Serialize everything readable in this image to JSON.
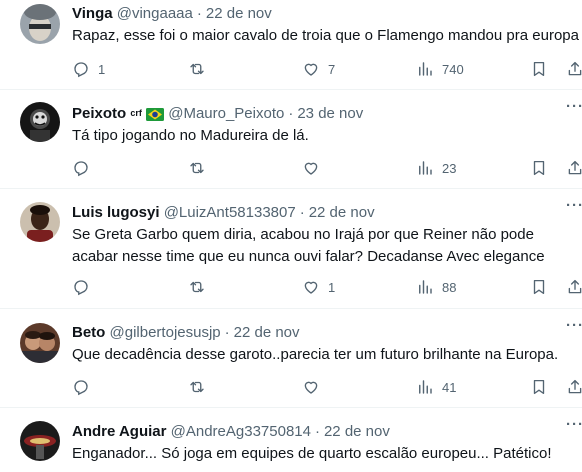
{
  "tweets": [
    {
      "name": "Vinga",
      "handle": "@vingaaaa",
      "date": "22 de nov",
      "text": [
        "Rapaz, esse foi o maior cavalo de troia que o Flamengo mandou pra europa"
      ],
      "stats": {
        "replies": "1",
        "reposts": "",
        "likes": "7",
        "views": "740"
      }
    },
    {
      "name": "Peixoto",
      "badge_text": "crf",
      "handle": "@Mauro_Peixoto",
      "date": "23 de nov",
      "text": [
        "Tá tipo jogando no Madureira de lá."
      ],
      "stats": {
        "replies": "",
        "reposts": "",
        "likes": "",
        "views": "23"
      }
    },
    {
      "name": "Luis lugosyi",
      "handle": "@LuizAnt58133807",
      "date": "22 de nov",
      "text": [
        "Se Greta Garbo quem diria, acabou no Irajá por que Reiner não pode",
        "acabar nesse time que eu nunca ouvi falar? Decadanse Avec elegance"
      ],
      "stats": {
        "replies": "",
        "reposts": "",
        "likes": "1",
        "views": "88"
      }
    },
    {
      "name": "Beto",
      "handle": "@gilbertojesusjp",
      "date": "22 de nov",
      "text": [
        "Que decadência desse garoto..parecia ter um futuro brilhante na Europa."
      ],
      "stats": {
        "replies": "",
        "reposts": "",
        "likes": "",
        "views": "41"
      }
    },
    {
      "name": "Andre Aguiar",
      "handle": "@AndreAg33750814",
      "date": "22 de nov",
      "text": [
        "Enganador... Só joga em equipes de quarto escalão europeu... Patético!"
      ],
      "stats": {
        "replies": "",
        "reposts": "",
        "likes": "",
        "views": ""
      }
    }
  ],
  "separator": "·",
  "more_glyph": "···",
  "icons": {
    "reply": "reply-icon",
    "repost": "repost-icon",
    "like": "like-icon",
    "views": "views-icon",
    "bookmark": "bookmark-icon",
    "share": "share-icon",
    "verified_flag": "brazil-flag-icon"
  },
  "colors": {
    "text_primary": "#0f1419",
    "text_secondary": "#536471",
    "divider": "#eff3f4"
  }
}
